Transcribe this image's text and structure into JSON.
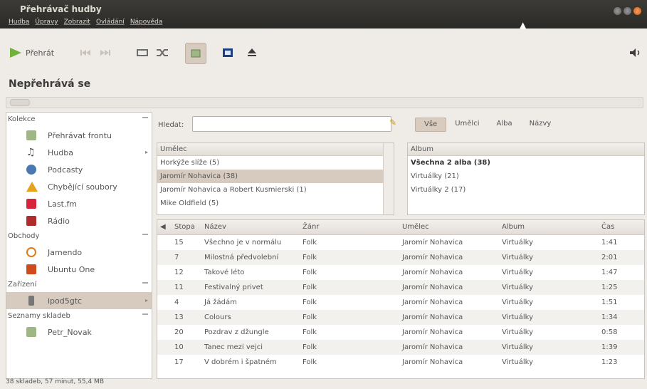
{
  "window": {
    "title": "Přehrávač hudby",
    "menu": [
      "Hudba",
      "Úpravy",
      "Zobrazit",
      "Ovládání",
      "Nápověda"
    ]
  },
  "toolbar": {
    "play_label": "Přehrát",
    "icons": [
      "play-icon",
      "previous-icon",
      "next-icon",
      "repeat-icon",
      "shuffle-icon",
      "browse-icon",
      "visualizer-icon",
      "eject-icon",
      "volume-icon"
    ]
  },
  "status": {
    "title": "Nepřehrává se"
  },
  "sidebar": {
    "groups": [
      {
        "label": "Kolekce",
        "items": [
          {
            "label": "Přehrávat frontu",
            "icon": "queue-icon",
            "color": "#9fb784"
          },
          {
            "label": "Hudba",
            "icon": "music-icon",
            "color": "#333333",
            "has_arrow": true
          },
          {
            "label": "Podcasty",
            "icon": "podcast-icon",
            "color": "#4a78b0"
          },
          {
            "label": "Chybějící soubory",
            "icon": "warning-icon",
            "color": "#e6a21c"
          },
          {
            "label": "Last.fm",
            "icon": "lastfm-icon",
            "color": "#d7243a"
          },
          {
            "label": "Rádio",
            "icon": "radio-icon",
            "color": "#b02c2c"
          }
        ]
      },
      {
        "label": "Obchody",
        "items": [
          {
            "label": "Jamendo",
            "icon": "jamendo-icon",
            "color": "#e07b14"
          },
          {
            "label": "Ubuntu One",
            "icon": "ubuntu-one-icon",
            "color": "#d14a1b"
          }
        ]
      },
      {
        "label": "Zařízení",
        "items": [
          {
            "label": "ipod5gtc",
            "icon": "ipod-icon",
            "color": "#777777",
            "selected": true,
            "has_arrow": true
          }
        ]
      },
      {
        "label": "Seznamy skladeb",
        "items": [
          {
            "label": "Petr_Novak",
            "icon": "playlist-icon",
            "color": "#9fb784"
          }
        ]
      }
    ]
  },
  "search": {
    "label": "Hledat:",
    "value": ""
  },
  "filter_tabs": [
    "Vše",
    "Umělci",
    "Alba",
    "Názvy"
  ],
  "artist_browser": {
    "header": "Umělec",
    "rows": [
      {
        "label": "Horkýže slíže (5)"
      },
      {
        "label": "Jaromír Nohavica (38)",
        "selected": true
      },
      {
        "label": "Jaromír Nohavica a Robert Kusmierski (1)"
      },
      {
        "label": "Mike Oldfield (5)"
      }
    ]
  },
  "album_browser": {
    "header": "Album",
    "rows": [
      {
        "label": "Všechna 2 alba (38)",
        "bold": true
      },
      {
        "label": "Virtuálky (21)"
      },
      {
        "label": "Virtuálky 2 (17)"
      }
    ]
  },
  "track_table": {
    "headers": [
      "Stopa",
      "Název",
      "Žánr",
      "Umělec",
      "Album",
      "Čas"
    ],
    "rows": [
      [
        "15",
        "Všechno je v normálu",
        "Folk",
        "Jaromír Nohavica",
        "Virtuálky",
        "1:41"
      ],
      [
        "7",
        "Milostná předvolební",
        "Folk",
        "Jaromír Nohavica",
        "Virtuálky",
        "2:01"
      ],
      [
        "12",
        "Takové léto",
        "Folk",
        "Jaromír Nohavica",
        "Virtuálky",
        "1:47"
      ],
      [
        "11",
        "Festivalný privet",
        "Folk",
        "Jaromír Nohavica",
        "Virtuálky",
        "1:25"
      ],
      [
        "4",
        "Já žádám",
        "Folk",
        "Jaromír Nohavica",
        "Virtuálky",
        "1:51"
      ],
      [
        "13",
        "Colours",
        "Folk",
        "Jaromír Nohavica",
        "Virtuálky",
        "1:34"
      ],
      [
        "20",
        "Pozdrav z džungle",
        "Folk",
        "Jaromír Nohavica",
        "Virtuálky",
        "0:58"
      ],
      [
        "10",
        "Tanec mezi vejci",
        "Folk",
        "Jaromír Nohavica",
        "Virtuálky",
        "1:39"
      ],
      [
        "17",
        "V dobrém i špatném",
        "Folk",
        "Jaromír Nohavica",
        "Virtuálky",
        "1:23"
      ]
    ]
  },
  "statusbar": {
    "text": "38 skladeb, 57 minut, 55,4 MB"
  }
}
